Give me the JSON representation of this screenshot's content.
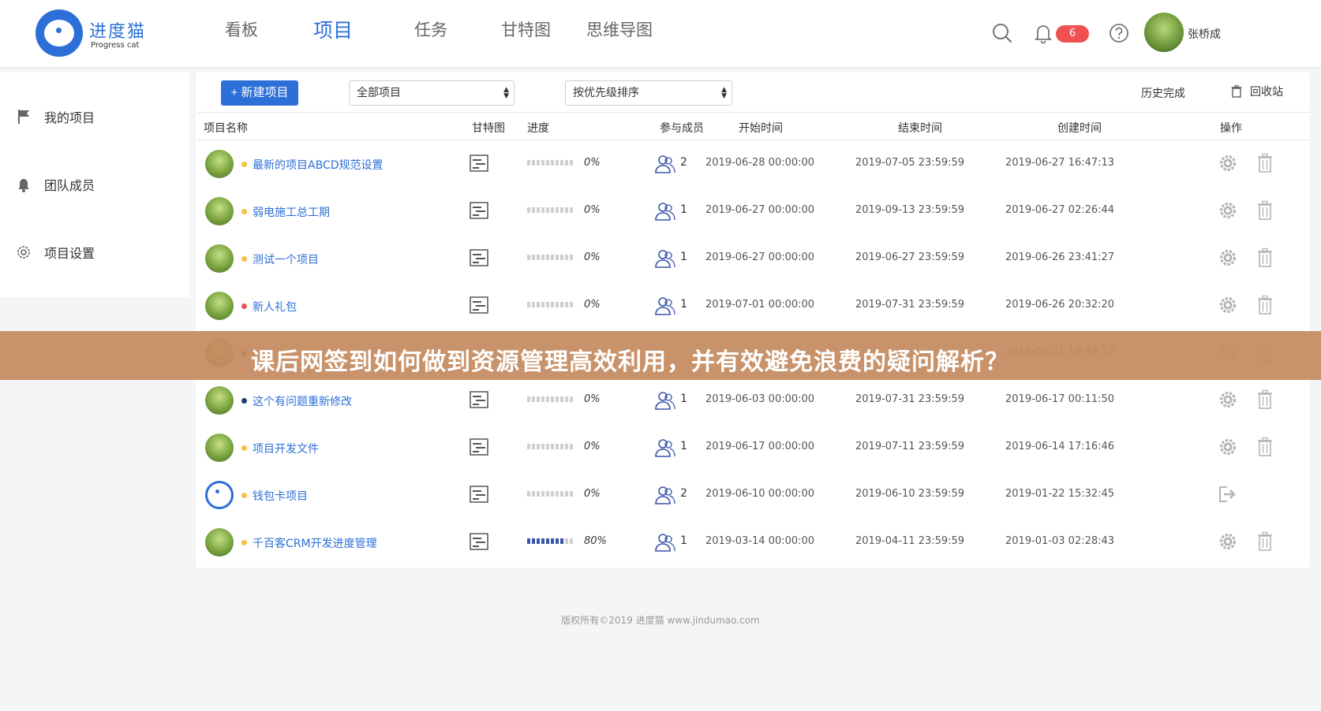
{
  "brand": {
    "name_cn": "进度猫",
    "name_en": "Progress cat",
    "color": "#2d6fd8"
  },
  "nav": {
    "items": [
      {
        "label": "看板",
        "active": false
      },
      {
        "label": "项目",
        "active": true
      },
      {
        "label": "任务",
        "active": false
      },
      {
        "label": "甘特图",
        "active": false
      },
      {
        "label": "思维导图",
        "active": false
      }
    ]
  },
  "header": {
    "notification_count": "6",
    "user_name": "张桥成",
    "icons": [
      "search-icon",
      "bell-icon",
      "help-icon"
    ]
  },
  "sidebar": {
    "items": [
      {
        "label": "我的项目",
        "icon": "flag-icon"
      },
      {
        "label": "团队成员",
        "icon": "bell-icon"
      },
      {
        "label": "项目设置",
        "icon": "gear-icon"
      }
    ]
  },
  "toolbar": {
    "new_button": "+ 新建项目",
    "filter_select": "全部项目",
    "sort_select": "按优先级排序",
    "history": "历史完成",
    "recycle": "回收站"
  },
  "table": {
    "columns": [
      "项目名称",
      "甘特图",
      "进度",
      "参与成员",
      "开始时间",
      "结束时间",
      "创建时间",
      "操作"
    ],
    "rows": [
      {
        "name": "最新的项目ABCD规范设置",
        "dot": "#f5c242",
        "progress": "0%",
        "progress_value": 0,
        "members": "2",
        "start": "2019-06-28 00:00:00",
        "end": "2019-07-05 23:59:59",
        "created": "2019-06-27 16:47:13",
        "action": "settings"
      },
      {
        "name": "弱电施工总工期",
        "dot": "#f5c242",
        "progress": "0%",
        "progress_value": 0,
        "members": "1",
        "start": "2019-06-27 00:00:00",
        "end": "2019-09-13 23:59:59",
        "created": "2019-06-27 02:26:44",
        "action": "settings"
      },
      {
        "name": "测试一个项目",
        "dot": "#f5c242",
        "progress": "0%",
        "progress_value": 0,
        "members": "1",
        "start": "2019-06-27 00:00:00",
        "end": "2019-06-27 23:59:59",
        "created": "2019-06-26 23:41:27",
        "action": "settings"
      },
      {
        "name": "新人礼包",
        "dot": "#e25555",
        "progress": "0%",
        "progress_value": 0,
        "members": "1",
        "start": "2019-07-01 00:00:00",
        "end": "2019-07-31 23:59:59",
        "created": "2019-06-26 20:32:20",
        "action": "settings"
      },
      {
        "name": "",
        "dot": "#555555",
        "progress": "",
        "progress_value": 0,
        "members": "",
        "start": "",
        "end": "",
        "created": "2019-06-21 19:49:12",
        "action": "settings",
        "hidden": true
      },
      {
        "name": "这个有问题重新修改",
        "dot": "#1f3b6e",
        "progress": "0%",
        "progress_value": 0,
        "members": "1",
        "start": "2019-06-03 00:00:00",
        "end": "2019-07-31 23:59:59",
        "created": "2019-06-17 00:11:50",
        "action": "settings"
      },
      {
        "name": "项目开发文件",
        "dot": "#f5c242",
        "progress": "0%",
        "progress_value": 0,
        "members": "1",
        "start": "2019-06-17 00:00:00",
        "end": "2019-07-11 23:59:59",
        "created": "2019-06-14 17:16:46",
        "action": "settings"
      },
      {
        "name": "钱包卡项目",
        "dot": "#f5c242",
        "progress": "0%",
        "progress_value": 0,
        "members": "2",
        "start": "2019-06-10 00:00:00",
        "end": "2019-06-10 23:59:59",
        "created": "2019-01-22 15:32:45",
        "action": "exit",
        "logo_avatar": true
      },
      {
        "name": "千百客CRM开发进度管理",
        "dot": "#f5c242",
        "progress": "80%",
        "progress_value": 0.8,
        "members": "1",
        "start": "2019-03-14 00:00:00",
        "end": "2019-04-11 23:59:59",
        "created": "2019-01-03 02:28:43",
        "action": "settings"
      }
    ]
  },
  "footer": "版权所有©2019 进度猫 www.jindumao.com",
  "banner": {
    "text": "课后网签到如何做到资源管理高效利用，并有效避免浪费的疑问解析？",
    "color": "#c48b60"
  }
}
